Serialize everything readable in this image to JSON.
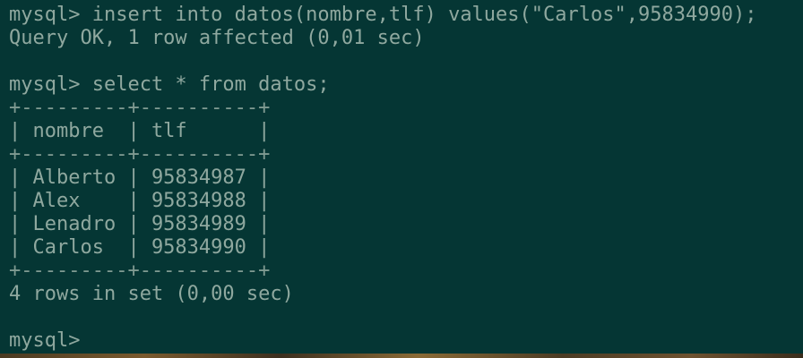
{
  "terminal": {
    "lines": [
      "mysql> insert into datos(nombre,tlf) values(\"Carlos\",95834990);",
      "Query OK, 1 row affected (0,01 sec)",
      "",
      "mysql> select * from datos;",
      "+---------+----------+",
      "| nombre  | tlf      |",
      "+---------+----------+",
      "| Alberto | 95834987 |",
      "| Alex    | 95834988 |",
      "| Lenadro | 95834989 |",
      "| Carlos  | 95834990 |",
      "+---------+----------+",
      "4 rows in set (0,00 sec)",
      "",
      "mysql> "
    ]
  },
  "colors": {
    "background": "#053634",
    "text": "#8fa89f"
  }
}
